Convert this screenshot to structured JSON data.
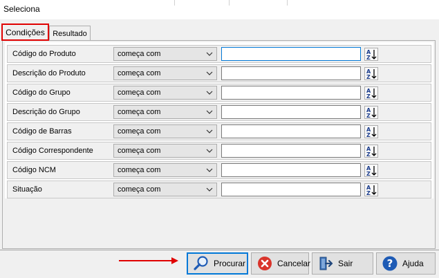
{
  "window": {
    "title": "Seleciona"
  },
  "tabs": [
    {
      "label": "Condições",
      "active": true
    },
    {
      "label": "Resultado",
      "active": false
    }
  ],
  "conditions": [
    {
      "label": "Código do Produto",
      "operator": "começa com",
      "value": ""
    },
    {
      "label": "Descrição do Produto",
      "operator": "começa com",
      "value": ""
    },
    {
      "label": "Código do Grupo",
      "operator": "começa com",
      "value": ""
    },
    {
      "label": "Descrição do Grupo",
      "operator": "começa com",
      "value": ""
    },
    {
      "label": "Código de Barras",
      "operator": "começa com",
      "value": ""
    },
    {
      "label": "Código Correspondente",
      "operator": "começa com",
      "value": ""
    },
    {
      "label": "Código NCM",
      "operator": "começa com",
      "value": ""
    },
    {
      "label": "Situação",
      "operator": "começa com",
      "value": ""
    }
  ],
  "buttons": {
    "procurar": "Procurar",
    "cancelar": "Cancelar",
    "sair": "Sair",
    "ajuda": "Ajuda"
  },
  "icons": {
    "select_chevron": "chevron-down-icon",
    "sort": "sort-az-icon",
    "procurar": "magnifier-icon",
    "cancelar": "cancel-x-icon",
    "sair": "exit-door-icon",
    "ajuda": "help-question-icon"
  },
  "colors": {
    "highlight": "#e00000",
    "focus": "#0078d7",
    "cancel_red": "#d9342b",
    "help_blue": "#1e5bb5"
  }
}
